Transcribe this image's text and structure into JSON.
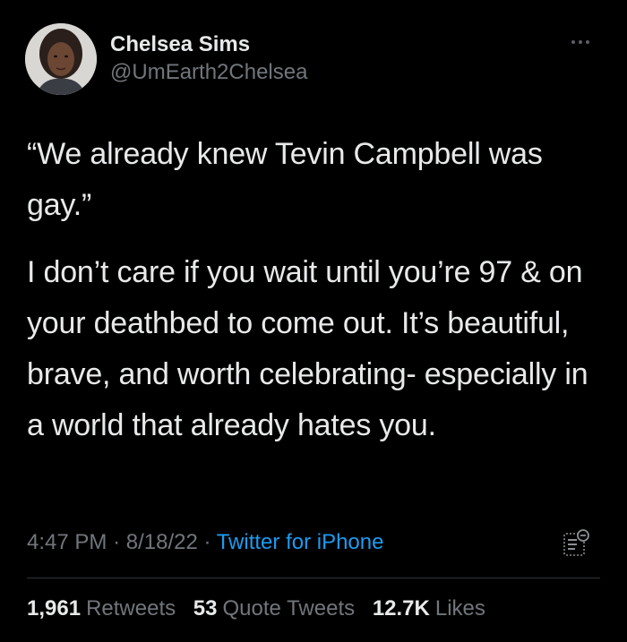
{
  "author": {
    "display_name": "Chelsea Sims",
    "handle": "@UmEarth2Chelsea"
  },
  "tweet": {
    "paragraphs": [
      "“We already knew Tevin Campbell was gay.”",
      "I don’t care if you wait until you’re 97 & on your deathbed to come out. It’s beautiful, brave, and worth celebrating- especially in a world that already hates you."
    ],
    "time": "4:47 PM",
    "date": "8/18/22",
    "separator": "·",
    "source": "Twitter for iPhone"
  },
  "stats": {
    "retweets_count": "1,961",
    "retweets_label": "Retweets",
    "quotes_count": "53",
    "quotes_label": "Quote Tweets",
    "likes_count": "12.7K",
    "likes_label": "Likes"
  },
  "icons": {
    "more": "more-options-icon",
    "analytics": "tweet-analytics-icon"
  },
  "colors": {
    "background": "#000000",
    "text": "#e7e9ea",
    "muted": "#71767b",
    "link": "#1d9bf0",
    "divider": "#2f3336"
  }
}
